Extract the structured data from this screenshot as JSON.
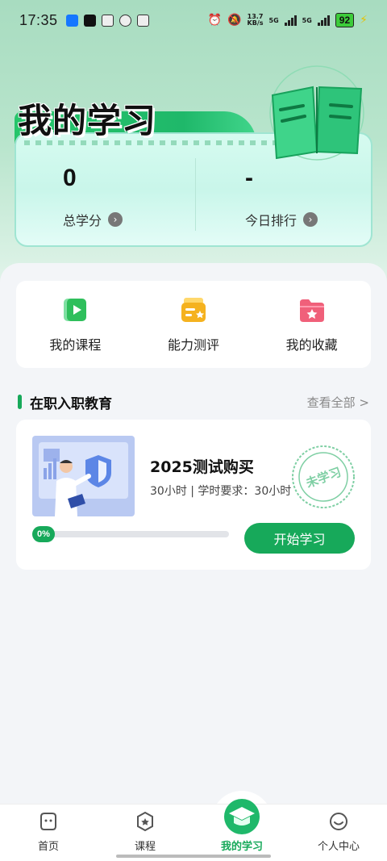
{
  "status_bar": {
    "time": "17:35",
    "net_speed_value": "13.7",
    "net_speed_unit": "KB/s",
    "sig1": "5G",
    "sig2": "5G",
    "battery": "92"
  },
  "hero": {
    "title": "我的学习",
    "stats": [
      {
        "value": "0",
        "label": "总学分"
      },
      {
        "value": "-",
        "label": "今日排行"
      }
    ]
  },
  "quick_actions": [
    {
      "label": "我的课程",
      "icon": "video-play-icon",
      "color": "#2fbf5c"
    },
    {
      "label": "能力测评",
      "icon": "evaluation-icon",
      "color": "#f5b21f"
    },
    {
      "label": "我的收藏",
      "icon": "star-folder-icon",
      "color": "#f0607a"
    }
  ],
  "section": {
    "title": "在职入职教育",
    "more": "查看全部 >"
  },
  "course": {
    "title": "2025测试购买",
    "meta": "30小时 | 学时要求：30小时",
    "stamp": "未学习",
    "progress_label": "0%",
    "progress": 0,
    "button": "开始学习"
  },
  "nav": {
    "items": [
      {
        "label": "首页",
        "icon": "home-face-icon"
      },
      {
        "label": "课程",
        "icon": "course-badge-icon"
      },
      {
        "label": "我的学习",
        "icon": "graduation-cap-icon"
      },
      {
        "label": "个人中心",
        "icon": "profile-smile-icon"
      }
    ]
  },
  "colors": {
    "accent": "#17a95a",
    "hero_green": "#25c56a"
  }
}
